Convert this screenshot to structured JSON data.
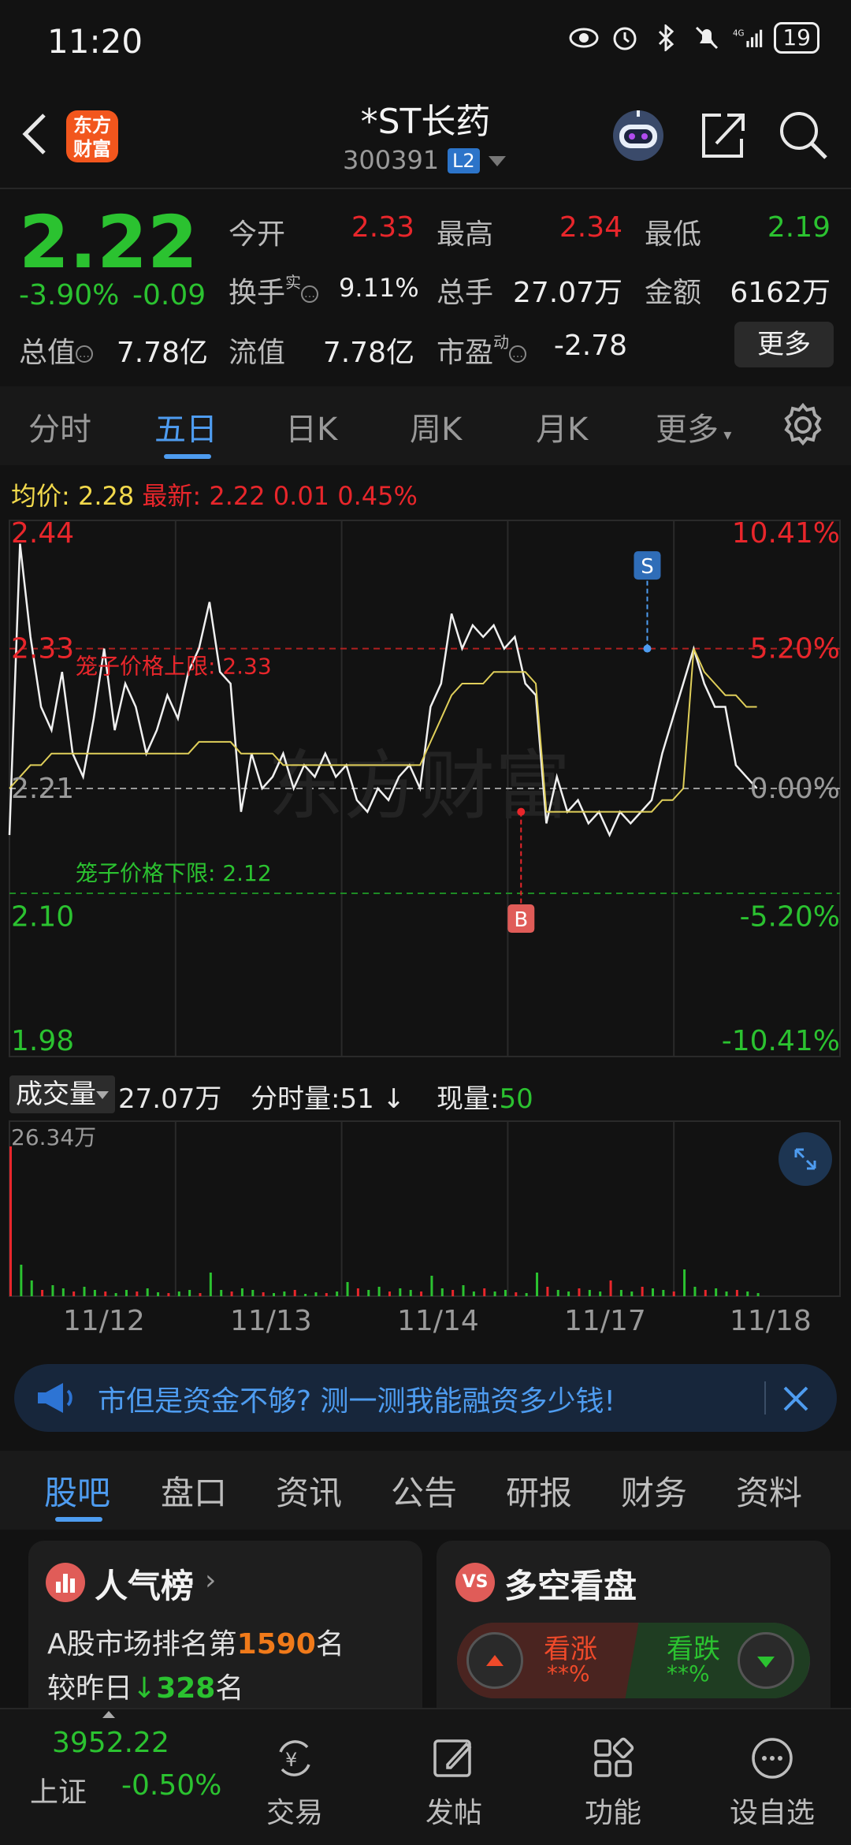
{
  "status_bar": {
    "time": "11:20",
    "battery": "19"
  },
  "header": {
    "logo_line1": "东方",
    "logo_line2": "财富",
    "stock_name": "*ST长药",
    "stock_code": "300391",
    "level_badge": "L2"
  },
  "quote": {
    "price": "2.22",
    "change_pct": "-3.90%",
    "change_amt": "-0.09",
    "open_label": "今开",
    "open_val": "2.33",
    "high_label": "最高",
    "high_val": "2.34",
    "low_label": "最低",
    "low_val": "2.19",
    "turnover_label": "换手",
    "turnover_sup": "实",
    "turnover_val": "9.11%",
    "volume_label": "总手",
    "volume_val": "27.07万",
    "amount_label": "金额",
    "amount_val": "6162万",
    "mktcap_label": "总值",
    "mktcap_val": "7.78亿",
    "float_label": "流值",
    "float_val": "7.78亿",
    "pe_label": "市盈",
    "pe_sup": "动",
    "pe_val": "-2.78",
    "more_button": "更多"
  },
  "chart_tabs": [
    "分时",
    "五日",
    "日K",
    "周K",
    "月K",
    "更多"
  ],
  "chart_info": {
    "avg_label": "均价:",
    "avg_val": "2.28",
    "latest_label": "最新:",
    "latest_val": "2.22",
    "latest_chg": "0.01",
    "latest_pct": "0.45%"
  },
  "chart_data": {
    "type": "line",
    "title": "",
    "y_left_ticks": [
      "2.44",
      "2.33",
      "2.21",
      "2.10",
      "1.98"
    ],
    "y_right_ticks": [
      "10.41%",
      "5.20%",
      "0.00%",
      "-5.20%",
      "-10.41%"
    ],
    "ylim": [
      1.98,
      2.44
    ],
    "x_days": [
      "11/12",
      "11/13",
      "11/14",
      "11/17",
      "11/18"
    ],
    "upper_limit_label": "笼子价格上限: 2.33",
    "lower_limit_label": "笼子价格下限: 2.12",
    "upper_limit": 2.33,
    "lower_limit": 2.12,
    "prev_close": 2.21,
    "buy_marker": "B",
    "sell_marker": "S",
    "watermark": "东方财富",
    "series": [
      {
        "values": [
          2.17,
          2.42,
          2.34,
          2.28,
          2.26,
          2.31,
          2.24,
          2.22,
          2.27,
          2.33,
          2.26,
          2.3,
          2.28,
          2.24,
          2.26,
          2.29,
          2.27,
          2.31,
          2.33,
          2.37,
          2.31,
          2.3,
          2.19,
          2.24,
          2.21,
          2.22,
          2.24,
          2.21,
          2.23,
          2.22,
          2.24,
          2.22,
          2.23,
          2.2,
          2.19,
          2.21,
          2.2,
          2.22,
          2.23,
          2.21,
          2.28,
          2.3,
          2.36,
          2.33,
          2.35,
          2.34,
          2.35,
          2.33,
          2.34,
          2.3,
          2.29,
          2.18,
          2.22,
          2.19,
          2.2,
          2.18,
          2.19,
          2.17,
          2.19,
          2.18,
          2.19,
          2.2,
          2.24,
          2.27,
          2.3,
          2.33,
          2.3,
          2.28,
          2.28,
          2.23,
          2.22,
          2.21
        ]
      },
      {
        "values": [
          2.21,
          2.22,
          2.23,
          2.23,
          2.24,
          2.24,
          2.24,
          2.24,
          2.24,
          2.24,
          2.24,
          2.24,
          2.24,
          2.24,
          2.24,
          2.24,
          2.24,
          2.24,
          2.25,
          2.25,
          2.25,
          2.25,
          2.24,
          2.24,
          2.24,
          2.24,
          2.23,
          2.23,
          2.23,
          2.23,
          2.23,
          2.23,
          2.23,
          2.23,
          2.23,
          2.23,
          2.23,
          2.23,
          2.23,
          2.23,
          2.25,
          2.27,
          2.29,
          2.3,
          2.3,
          2.3,
          2.31,
          2.31,
          2.31,
          2.31,
          2.3,
          2.19,
          2.19,
          2.19,
          2.19,
          2.19,
          2.19,
          2.19,
          2.19,
          2.19,
          2.19,
          2.19,
          2.2,
          2.2,
          2.21,
          2.33,
          2.31,
          2.3,
          2.29,
          2.29,
          2.28,
          2.28
        ]
      }
    ]
  },
  "volume": {
    "selector": "成交量",
    "total": "27.07万",
    "minute_label": "分时量:",
    "minute_val": "51",
    "current_label": "现量:",
    "current_val": "50",
    "max_label": "26.34万"
  },
  "banner": {
    "text": "市但是资金不够? 测一测我能融资多少钱!"
  },
  "section_tabs": [
    "股吧",
    "盘口",
    "资讯",
    "公告",
    "研报",
    "财务",
    "资料"
  ],
  "popularity": {
    "title": "人气榜",
    "rank_prefix": "A股市场排名第",
    "rank_num": "1590",
    "rank_suffix": "名",
    "cmp_prefix": "较昨日",
    "cmp_num": "328",
    "cmp_suffix": "名"
  },
  "bull_bear": {
    "title": "多空看盘",
    "icon_text": "VS",
    "up_label": "看涨",
    "up_val": "**%",
    "down_label": "看跌",
    "down_val": "**%"
  },
  "bottom_nav": {
    "index_val": "3952.22",
    "index_name": "上证",
    "index_chg": "-0.50%",
    "items": [
      "交易",
      "发帖",
      "功能",
      "设自选"
    ]
  }
}
